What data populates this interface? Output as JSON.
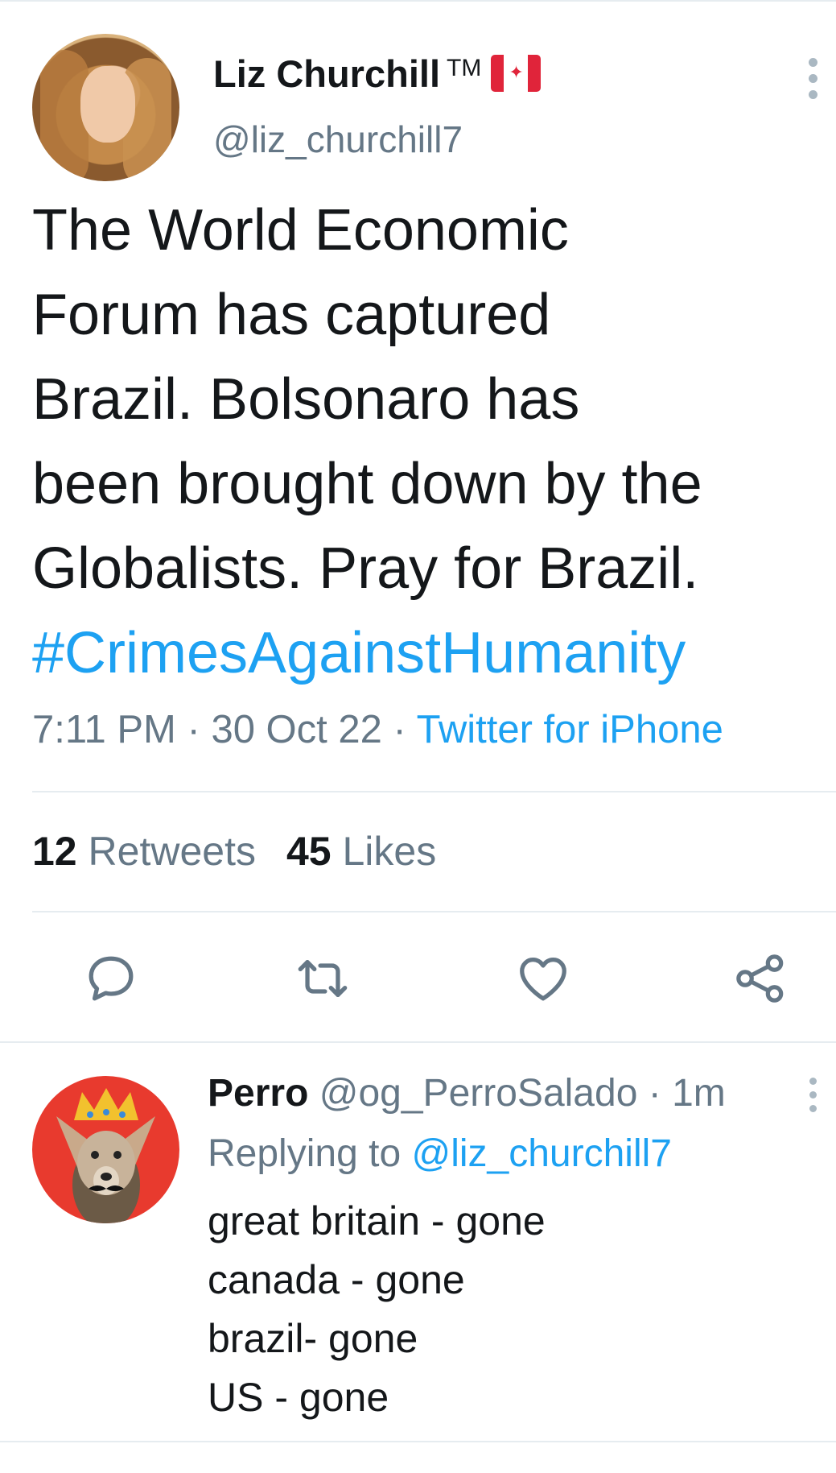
{
  "tweet": {
    "author_name": "Liz Churchill",
    "trademark": "TM",
    "author_handle": "@liz_churchill7",
    "text_lines": [
      "The World Economic",
      "Forum has captured",
      "Brazil. Bolsonaro has",
      "been brought down by the",
      "Globalists. Pray for Brazil."
    ],
    "hashtag": "#CrimesAgainstHumanity",
    "time": "7:11 PM",
    "date": "30 Oct 22",
    "separator": "·",
    "source": "Twitter for iPhone",
    "retweets_count": "12",
    "retweets_label": "Retweets",
    "likes_count": "45",
    "likes_label": "Likes"
  },
  "reply": {
    "author_name": "Perro",
    "author_handle": "@og_PerroSalado",
    "time_ago": "1m",
    "replying_prefix": "Replying to",
    "replying_to": "@liz_churchill7",
    "lines": [
      "great britain - gone",
      "canada - gone",
      "brazil- gone",
      "US - gone"
    ]
  },
  "icons": {
    "flag": "canada-flag-icon",
    "more": "more-vertical-icon",
    "reply": "reply-icon",
    "retweet": "retweet-icon",
    "like": "heart-icon",
    "share": "share-icon"
  },
  "colors": {
    "accent": "#1da1f2",
    "secondary_text": "#657786",
    "primary_text": "#14171a",
    "divider": "#e6ecf0",
    "icon": "#657786"
  }
}
